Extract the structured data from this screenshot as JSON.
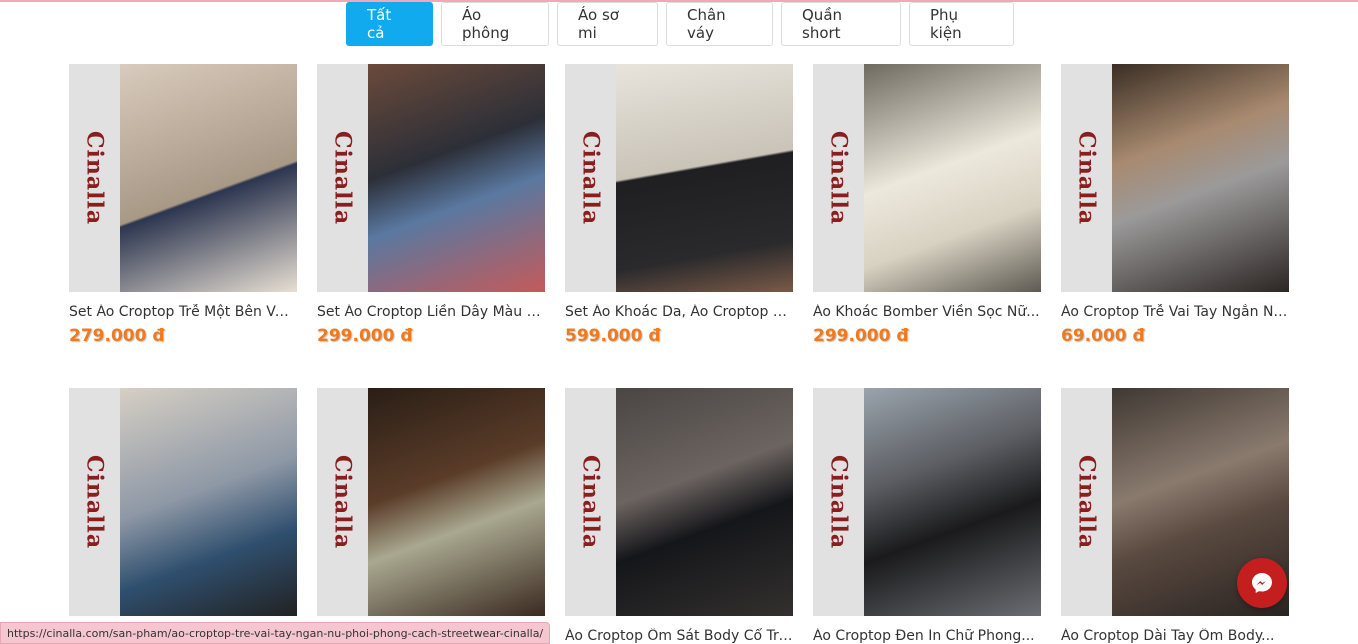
{
  "tabs": [
    {
      "label": "Tất cả",
      "active": true
    },
    {
      "label": "Áo phông",
      "active": false
    },
    {
      "label": "Áo sơ mi",
      "active": false
    },
    {
      "label": "Chân váy",
      "active": false
    },
    {
      "label": "Quần short",
      "active": false
    },
    {
      "label": "Phụ kiện",
      "active": false
    }
  ],
  "brand_text": "Cinalla",
  "products": [
    {
      "title": "Set Áo Croptop Trễ Một Bên Vai...",
      "price": "279.000 đ",
      "photo": "#c9b8a8"
    },
    {
      "title": "Set Áo Croptop Liền Dây Màu Be...",
      "price": "299.000 đ",
      "photo": "#4a5a70"
    },
    {
      "title": "Set Áo Khoác Da, Áo Croptop Đe...",
      "price": "599.000 đ",
      "photo": "#bdb7ae"
    },
    {
      "title": "Áo Khoác Bomber Viền Sọc Nữ...",
      "price": "299.000 đ",
      "photo": "#a69f94"
    },
    {
      "title": "Áo Croptop Trễ Vai Tay Ngắn Nữ...",
      "price": "69.000 đ",
      "photo": "#8a7a68"
    },
    {
      "title": "",
      "price": "",
      "photo": "#6d7a8a"
    },
    {
      "title": "",
      "price": "",
      "photo": "#5a4638"
    },
    {
      "title": "Áo Croptop Ôm Sát Body Cổ Trò...",
      "price": "",
      "photo": "#3c3a3c"
    },
    {
      "title": "Áo Croptop Đen In Chữ Phong...",
      "price": "",
      "photo": "#4d4f55"
    },
    {
      "title": "Áo Croptop Dài Tay Ôm Body...",
      "price": "",
      "photo": "#6e625a"
    }
  ],
  "status_url": "https://cinalla.com/san-pham/ao-croptop-tre-vai-tay-ngan-nu-phoi-phong-cach-streetwear-cinalla/",
  "messenger_icon": "messenger-icon"
}
